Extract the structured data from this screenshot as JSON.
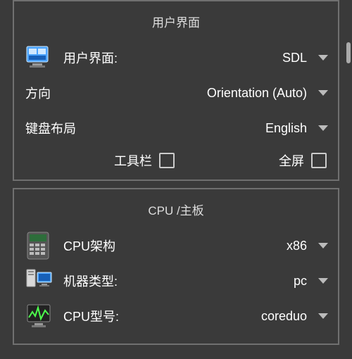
{
  "colors": {
    "panel_border": "#707070",
    "bg": "#3a3a3a",
    "fg": "#ffffff",
    "chev": "#bbbbbb"
  },
  "section_ui": {
    "title": "用户界面",
    "rows": {
      "ui": {
        "label": "用户界面:",
        "value": "SDL"
      },
      "orient": {
        "label": "方向",
        "value": "Orientation (Auto)"
      },
      "kbd": {
        "label": "键盘布局",
        "value": "English"
      }
    },
    "checks": {
      "toolbar": {
        "label": "工具栏",
        "checked": false
      },
      "fullscreen": {
        "label": "全屏",
        "checked": false
      }
    }
  },
  "section_cpu": {
    "title": "CPU /主板",
    "rows": {
      "arch": {
        "label": "CPU架构",
        "value": "x86"
      },
      "machine": {
        "label": "机器类型:",
        "value": "pc"
      },
      "model": {
        "label": "CPU型号:",
        "value": "coreduo"
      }
    }
  }
}
